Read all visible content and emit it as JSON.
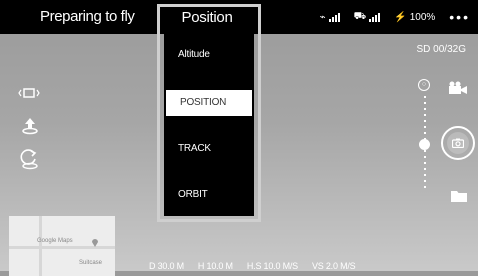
{
  "top_bar": {
    "status": "Preparing to fly",
    "mode": "Position",
    "battery": "100%",
    "menu": "•••"
  },
  "storage": "SD 00/32G",
  "mode_dropdown": {
    "items": [
      "Altitude",
      "POSITION",
      "TRACK",
      "ORBIT"
    ],
    "selected": "POSITION"
  },
  "map": {
    "labels": [
      "Google Maps",
      "Suitcase"
    ]
  },
  "telemetry": {
    "distance": "D 30.0 M",
    "height": "H 10.0 M",
    "h_speed": "H.S 10.0 M/S",
    "v_speed": "VS  2.0 M/S"
  },
  "icons": {
    "left": [
      "aspect-ratio-icon",
      "takeoff-icon",
      "return-home-icon"
    ],
    "right": [
      "video-camera-icon",
      "camera-shutter-icon",
      "folder-icon"
    ]
  }
}
